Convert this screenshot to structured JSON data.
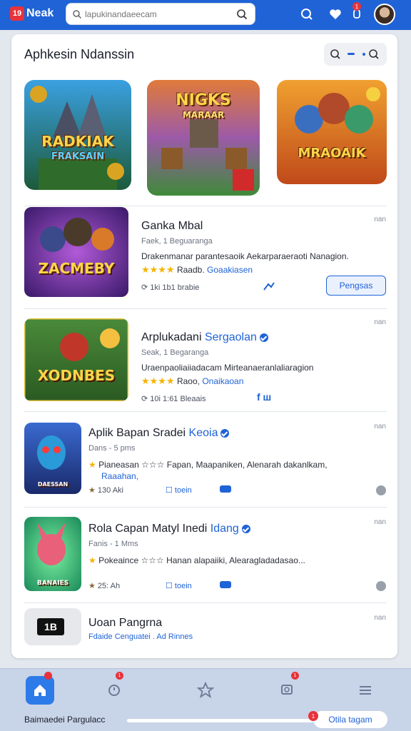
{
  "header": {
    "logo_badge": "19",
    "logo_text": "Neak",
    "search_placeholder": "lapukinandaeecam",
    "notif_count": "1"
  },
  "card": {
    "title": "Aphkesin Ndanssin"
  },
  "featured": [
    {
      "label_top": "RADKIAK",
      "label_bottom": "FRAKSAIN"
    },
    {
      "label_top": "NIGKS",
      "label_bottom": "MARAAR"
    },
    {
      "label_top": "MRAOAIK",
      "label_bottom": ""
    }
  ],
  "apps": [
    {
      "icon_label": "ZACMEBY",
      "name": "Ganka Mbal",
      "tag": "",
      "meta": "Faek, 1 Beguaranga",
      "desc": "Drakenmanar parantesaoik Aekarparaeraoti Nanagion.",
      "stars": "★★★★",
      "rating_text": "Raadb.",
      "rating_link": "Goaakiasen",
      "stats": "1ki 1b1 brabie",
      "size": "nan",
      "action": "Pengsas"
    },
    {
      "icon_label": "XODNBES",
      "name": "Arplukadani",
      "tag": "Sergaolan",
      "meta": "Seak, 1 Begaranga",
      "desc": "Uraenpaoliaiiadacam Mirteanaeranlaliaragion",
      "stars": "★★★★",
      "rating_text": "Raoo,",
      "rating_link": "Onaikaoan",
      "stats": "10i 1:61 Bleaais",
      "size": "nan",
      "action": ""
    },
    {
      "icon_label": "DAESSAN",
      "name": "Aplik Bapan Sradei",
      "tag": "Keoia",
      "meta": "Dans - 5 pms",
      "desc": "Pianeasan ☆☆☆ Fapan, Maapaniken, Alenarah dakanlkam,",
      "desc2": "Raaahan,",
      "stars": "★",
      "rating_text": "",
      "rating_link": "",
      "stats": "130 Aki",
      "install": "toein",
      "size": "nan"
    },
    {
      "icon_label": "BANAIES",
      "name": "Rola Capan Matyl Inedi",
      "tag": "Idang",
      "meta": "Fanis - 1 Mms",
      "desc": "Pokeaince ☆☆☆ Hanan alapaiiki, Alearagladadasao...",
      "stars": "★",
      "stats": "25: Ah",
      "install": "toein",
      "size": "nan"
    },
    {
      "icon_label": "1B",
      "name": "Uoan Pangrna",
      "tag": "",
      "meta": "Fdaide Cenguatei . Ad Rinnes",
      "size": "nan"
    }
  ],
  "bottom_nav": {
    "badges": [
      "1",
      "1"
    ],
    "footer_left": "Baimaedei Pargulacc",
    "footer_button": "Otila tagam",
    "footer_badge": "1",
    "progress": 0.98
  },
  "colors": {
    "brand": "#1f63d6",
    "accent_red": "#e8333b",
    "star": "#f5b301"
  }
}
